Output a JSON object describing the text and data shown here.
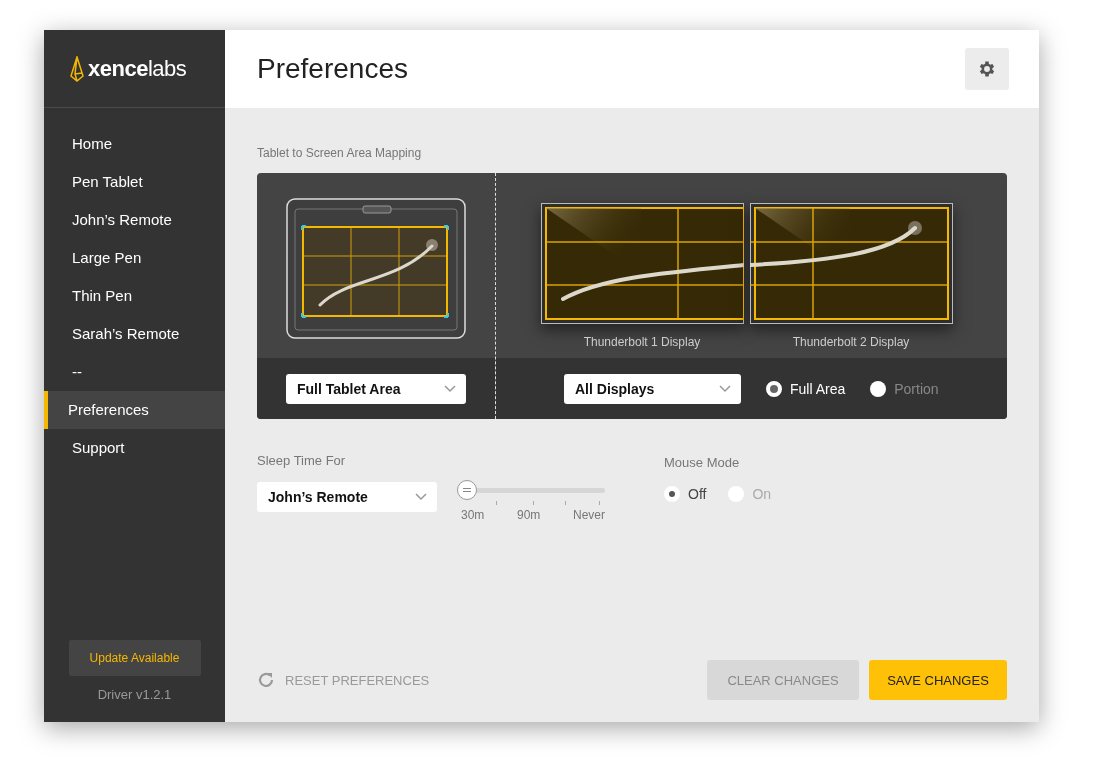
{
  "logo": {
    "text": "**xence**labs"
  },
  "sidebar": {
    "items": [
      {
        "label": "Home",
        "selected": false
      },
      {
        "label": "Pen Tablet",
        "selected": false
      },
      {
        "label": "John’s Remote",
        "selected": false
      },
      {
        "label": "Large Pen",
        "selected": false
      },
      {
        "label": "Thin Pen",
        "selected": false
      },
      {
        "label": "Sarah’s Remote",
        "selected": false
      },
      {
        "label": "--",
        "selected": false
      },
      {
        "label": "Preferences",
        "selected": true
      },
      {
        "label": "Support",
        "selected": false
      }
    ],
    "update_button": "Update Available",
    "driver_version": "Driver v1.2.1"
  },
  "header": {
    "title": "Preferences"
  },
  "mapping": {
    "title": "Tablet to Screen Area Mapping",
    "displays": [
      {
        "label": "Thunderbolt 1 Display"
      },
      {
        "label": "Thunderbolt 2 Display"
      }
    ],
    "tablet_area": "Full Tablet Area",
    "display_select": "All Displays",
    "area_options": [
      {
        "label": "Full Area",
        "selected": true
      },
      {
        "label": "Portion",
        "selected": false
      }
    ]
  },
  "sleep": {
    "label": "Sleep Time For",
    "device": "John’s Remote",
    "level": 0,
    "ticks": [
      "30m",
      "90m",
      "Never"
    ]
  },
  "mouse_mode": {
    "label": "Mouse Mode",
    "options": [
      {
        "label": "Off",
        "selected": true
      },
      {
        "label": "On",
        "selected": false
      }
    ]
  },
  "footer": {
    "reset": "RESET PREFERENCES",
    "clear": "CLEAR CHANGES",
    "save": "SAVE CHANGES"
  }
}
